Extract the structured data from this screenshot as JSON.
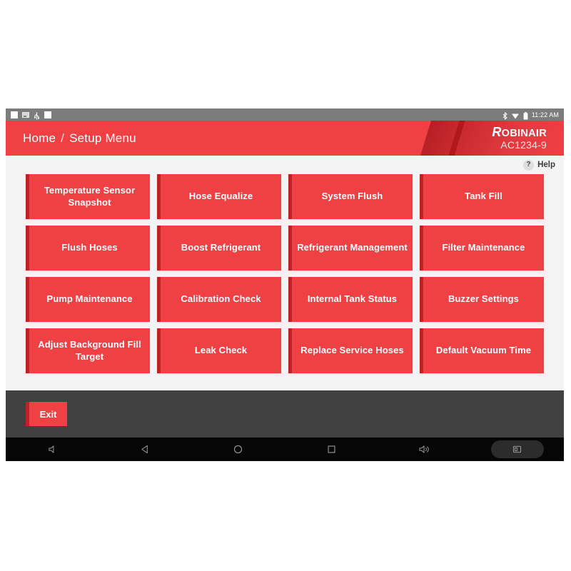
{
  "statusbar": {
    "icons_left": [
      "white-square-icon",
      "sd-card-icon",
      "usb-icon",
      "white-square-icon"
    ],
    "icons_right": [
      "bluetooth-icon",
      "wifi-icon",
      "battery-icon"
    ],
    "time": "11:22 AM"
  },
  "header": {
    "breadcrumb": {
      "home": "Home",
      "separator": "/",
      "current": "Setup Menu"
    },
    "brand_initial": "R",
    "brand_rest": "OBINAIR",
    "model": "AC1234-9",
    "accent_color": "#ef4044",
    "accent_dark": "#bf2126"
  },
  "content": {
    "help_label": "Help",
    "help_icon_glyph": "?",
    "tiles": [
      "Temperature Sensor Snapshot",
      "Hose Equalize",
      "System Flush",
      "Tank Fill",
      "Flush Hoses",
      "Boost Refrigerant",
      "Refrigerant Management",
      "Filter Maintenance",
      "Pump Maintenance",
      "Calibration Check",
      "Internal Tank Status",
      "Buzzer Settings",
      "Adjust Background Fill Target",
      "Leak Check",
      "Replace Service Hoses",
      "Default Vacuum Time"
    ]
  },
  "footer": {
    "exit_label": "Exit"
  },
  "navbar": {
    "buttons": [
      "volume-down-icon",
      "back-icon",
      "home-icon",
      "recents-icon",
      "volume-up-icon",
      "screenshot-icon"
    ]
  }
}
